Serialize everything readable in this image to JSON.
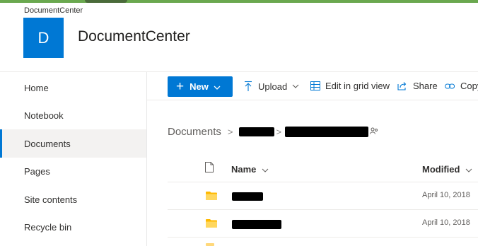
{
  "site": {
    "breadcrumb": "DocumentCenter",
    "logo_letter": "D",
    "title": "DocumentCenter",
    "logo_color": "#0078d4"
  },
  "nav": {
    "items": [
      {
        "label": "Home",
        "selected": false
      },
      {
        "label": "Notebook",
        "selected": false
      },
      {
        "label": "Documents",
        "selected": true
      },
      {
        "label": "Pages",
        "selected": false
      },
      {
        "label": "Site contents",
        "selected": false
      },
      {
        "label": "Recycle bin",
        "selected": false
      }
    ]
  },
  "commandbar": {
    "new_label": "New",
    "upload_label": "Upload",
    "grid_label": "Edit in grid view",
    "share_label": "Share",
    "copy_label": "Copy"
  },
  "library": {
    "breadcrumb_root": "Documents",
    "columns": {
      "name": "Name",
      "modified": "Modified"
    },
    "rows": [
      {
        "modified": "April 10, 2018"
      },
      {
        "modified": "April 10, 2018"
      }
    ]
  },
  "icons": {
    "new": "plus-icon",
    "upload": "upload-arrow-icon",
    "grid": "grid-view-icon",
    "share": "share-icon",
    "copy": "copy-link-icon",
    "file_header": "file-type-icon",
    "folder": "folder-icon",
    "people": "shared-people-icon"
  },
  "colors": {
    "accent": "#0078d4",
    "folder": "#ffb900",
    "top_strip": "#6aa84f"
  }
}
